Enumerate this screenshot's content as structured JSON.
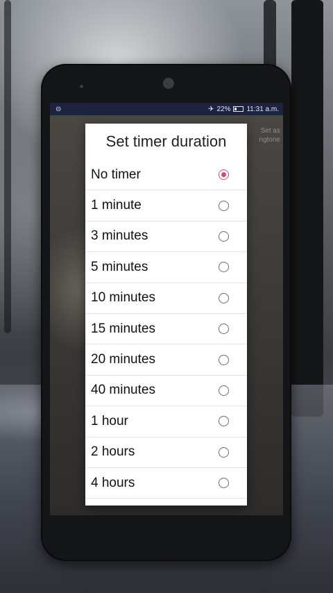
{
  "status_bar": {
    "left_icon": "circle-notification-icon",
    "airplane_icon": "airplane-icon",
    "battery_percent": "22%",
    "time": "11:31 a.m."
  },
  "background_hint": {
    "line1": "Set as",
    "line2": "ngtone"
  },
  "dialog": {
    "title": "Set timer duration",
    "accent_color": "#d9477a",
    "options": [
      {
        "label": "No timer",
        "selected": true
      },
      {
        "label": "1 minute",
        "selected": false
      },
      {
        "label": "3 minutes",
        "selected": false
      },
      {
        "label": "5 minutes",
        "selected": false
      },
      {
        "label": "10 minutes",
        "selected": false
      },
      {
        "label": "15 minutes",
        "selected": false
      },
      {
        "label": "20 minutes",
        "selected": false
      },
      {
        "label": "40 minutes",
        "selected": false
      },
      {
        "label": "1 hour",
        "selected": false
      },
      {
        "label": "2 hours",
        "selected": false
      },
      {
        "label": "4 hours",
        "selected": false
      }
    ]
  }
}
